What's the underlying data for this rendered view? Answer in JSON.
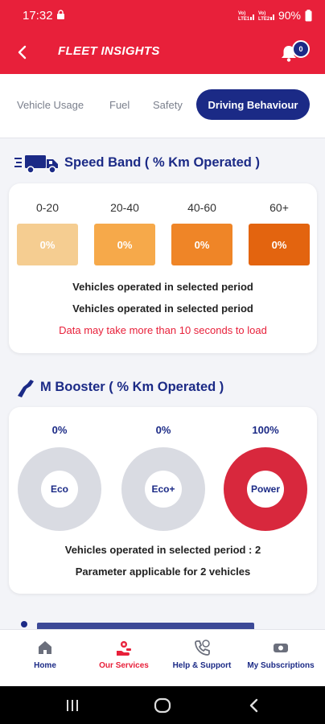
{
  "status_bar": {
    "time": "17:32",
    "sim1": "Vo) LTE\nLTE1",
    "sim2": "Vo) LTE\nLTE2",
    "battery": "90%"
  },
  "header": {
    "title": "FLEET INSIGHTS",
    "notification_count": "0"
  },
  "tabs": [
    {
      "label": "Vehicle Usage",
      "active": false
    },
    {
      "label": "Fuel",
      "active": false
    },
    {
      "label": "Safety",
      "active": false
    },
    {
      "label": "Driving Behaviour",
      "active": true
    }
  ],
  "speed_band": {
    "title": "Speed Band ( % Km Operated )",
    "bands": [
      {
        "label": "0-20",
        "value": "0%",
        "color": "#f5cd91"
      },
      {
        "label": "20-40",
        "value": "0%",
        "color": "#f6a94a"
      },
      {
        "label": "40-60",
        "value": "0%",
        "color": "#ef8527"
      },
      {
        "label": "60+",
        "value": "0%",
        "color": "#e3640f"
      }
    ],
    "line1": "Vehicles operated in selected period",
    "line2": "Vehicles operated in selected period",
    "notice": "Data may take more than 10 seconds to load"
  },
  "m_booster": {
    "title": "M Booster ( % Km Operated )",
    "modes": [
      {
        "label": "Eco",
        "value": "0%",
        "fraction": 0
      },
      {
        "label": "Eco+",
        "value": "0%",
        "fraction": 0
      },
      {
        "label": "Power",
        "value": "100%",
        "fraction": 1
      }
    ],
    "line1": "Vehicles operated in selected period : 2",
    "line2": "Parameter applicable for 2 vehicles"
  },
  "colors": {
    "brand_red": "#e8203a",
    "navy": "#1b2a86",
    "ring_empty": "#d9dbe2",
    "ring_power": "#d8283d"
  },
  "bottom_nav": [
    {
      "label": "Home",
      "icon": "home-icon",
      "active": false
    },
    {
      "label": "Our Services",
      "icon": "services-icon",
      "active": true
    },
    {
      "label": "Help & Support",
      "icon": "support-icon",
      "active": false
    },
    {
      "label": "My Subscriptions",
      "icon": "subscriptions-icon",
      "active": false
    }
  ]
}
